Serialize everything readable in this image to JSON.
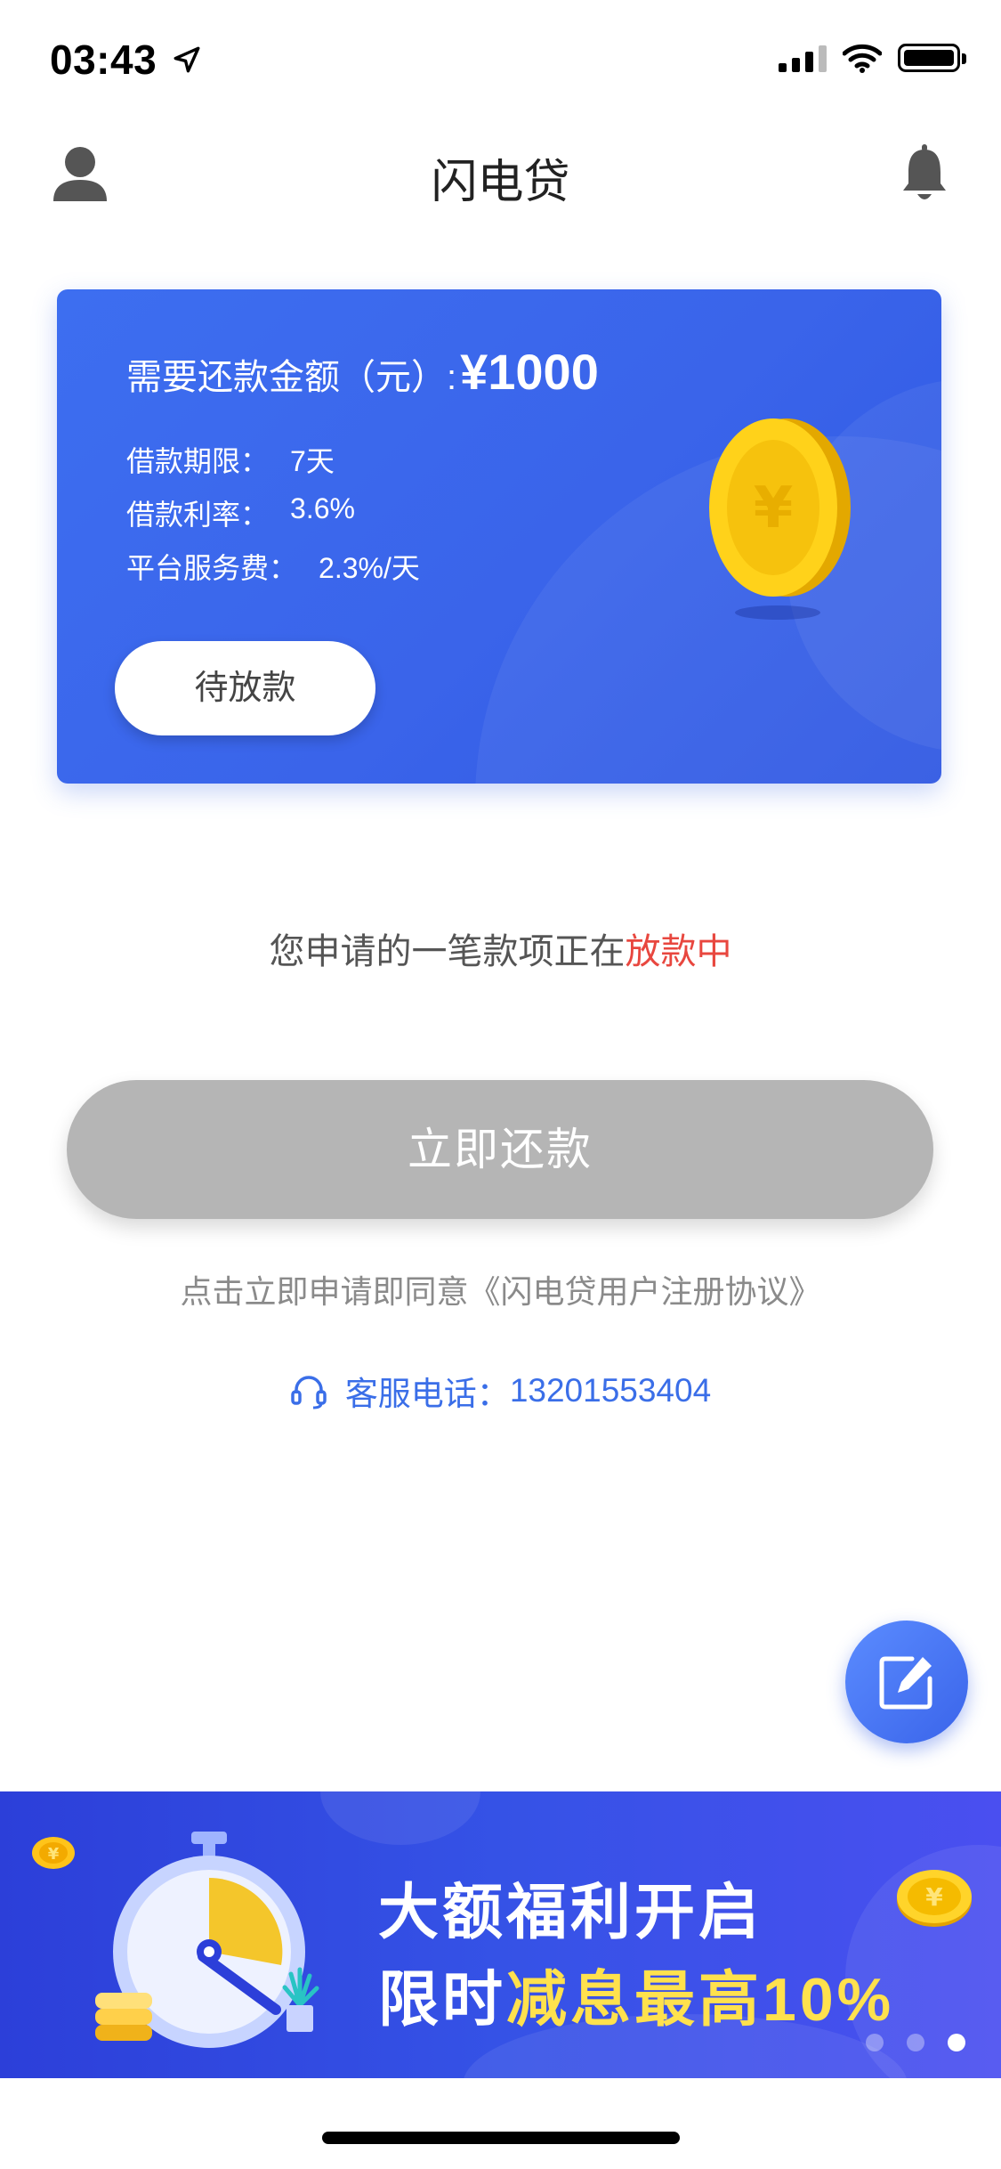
{
  "status_bar": {
    "time": "03:43"
  },
  "nav": {
    "title": "闪电贷"
  },
  "card": {
    "amount_label": "需要还款金额（元）:",
    "amount_value": "¥1000",
    "term_label": "借款期限：",
    "term_value": "7天",
    "rate_label": "借款利率：",
    "rate_value": "3.6%",
    "fee_label": "平台服务费：",
    "fee_value": "2.3%/天",
    "status_button": "待放款"
  },
  "message": {
    "prefix": "您申请的一笔款项正在",
    "highlight": "放款中",
    "highlight_color": "#e8473f"
  },
  "repay_button": "立即还款",
  "agreement": "点击立即申请即同意《闪电贷用户注册协议》",
  "service": {
    "label": "客服电话：",
    "phone": "13201553404"
  },
  "banner": {
    "line1": "大额福利开启",
    "line2_prefix": "限时",
    "line2_highlight": "减息最高10%",
    "active_slide": 3,
    "slide_count": 3
  },
  "colors": {
    "primary": "#3a64ea",
    "accent_red": "#e8473f",
    "button_disabled": "#b5b5b5",
    "link_blue": "#3a6ee8"
  },
  "icons": [
    "location-arrow-icon",
    "signal-icon",
    "wifi-icon",
    "battery-icon",
    "user-icon",
    "bell-icon",
    "coin-icon",
    "headset-icon",
    "edit-icon"
  ]
}
